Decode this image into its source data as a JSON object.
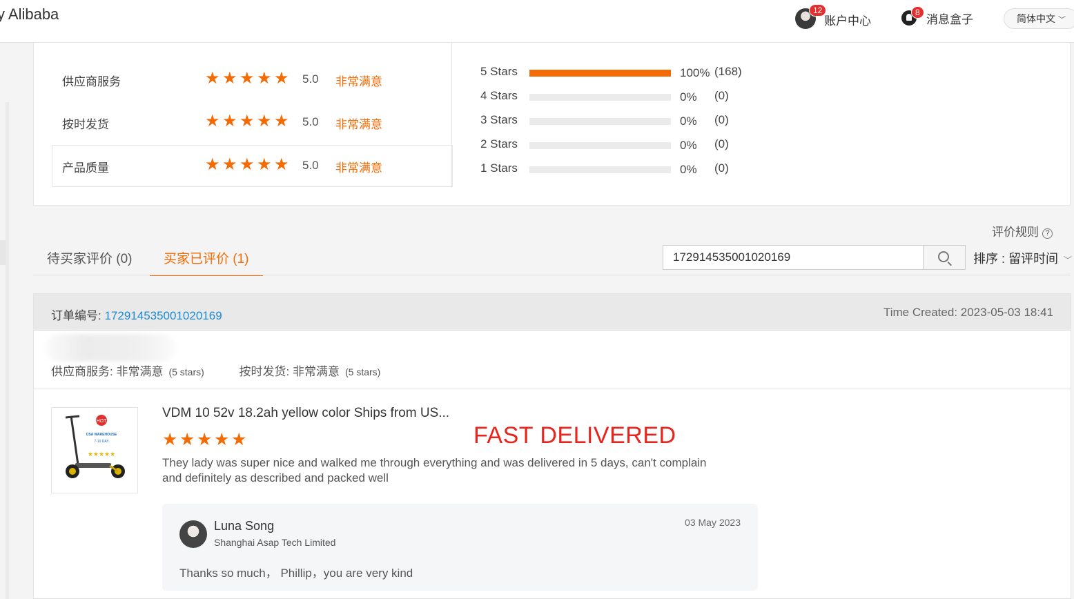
{
  "header": {
    "brand": "y Alibaba",
    "account_badge": "12",
    "account_label": "账户中心",
    "messages_badge": "8",
    "messages_label": "消息盒子",
    "language": "简体中文"
  },
  "ratings": [
    {
      "label": "供应商服务",
      "stars": 5,
      "score": "5.0",
      "verdict": "非常满意"
    },
    {
      "label": "按时发货",
      "stars": 5,
      "score": "5.0",
      "verdict": "非常满意"
    },
    {
      "label": "产品质量",
      "stars": 5,
      "score": "5.0",
      "verdict": "非常满意"
    }
  ],
  "distribution": [
    {
      "label": "5  Stars",
      "percent": "100%",
      "count": "(168)",
      "fill": 1.0
    },
    {
      "label": "4  Stars",
      "percent": "0%",
      "count": "(0)",
      "fill": 0
    },
    {
      "label": "3  Stars",
      "percent": "0%",
      "count": "(0)",
      "fill": 0
    },
    {
      "label": "2  Stars",
      "percent": "0%",
      "count": "(0)",
      "fill": 0
    },
    {
      "label": "1  Stars",
      "percent": "0%",
      "count": "(0)",
      "fill": 0
    }
  ],
  "rules_label": "评价规则",
  "tabs": {
    "pending": "待买家评价 (0)",
    "reviewed": "买家已评价 (1)"
  },
  "search": {
    "value": "172914535001020169",
    "icon": "search-icon"
  },
  "sort_label": "排序 : 留评时间",
  "order": {
    "number_label": "订单编号:",
    "number": "172914535001020169",
    "time_created": "Time Created: 2023-05-03 18:41",
    "sub_ratings": [
      {
        "label": "供应商服务: 非常满意",
        "stars": "(5 stars)"
      },
      {
        "label": "按时发货: 非常满意",
        "stars": "(5 stars)"
      }
    ]
  },
  "review": {
    "product_title": "VDM 10 52v 18.2ah yellow color Ships from US...",
    "stars": 5,
    "annotation": "FAST DELIVERED",
    "text": "They lady was super nice and walked me through everything and was delivered in 5 days, can't complain and definitely as described and packed well",
    "thumb_hot": "HOT",
    "thumb_line1": "USA WAREHOUSE",
    "thumb_line2": "7-10 DAY"
  },
  "reply": {
    "name": "Luna Song",
    "company": "Shanghai Asap Tech Limited",
    "date": "03 May 2023",
    "text": "Thanks so much， Phillip，you are very kind"
  },
  "colors": {
    "accent": "#f36b05",
    "link": "#1a8bd6",
    "annotation": "#e8241c"
  }
}
